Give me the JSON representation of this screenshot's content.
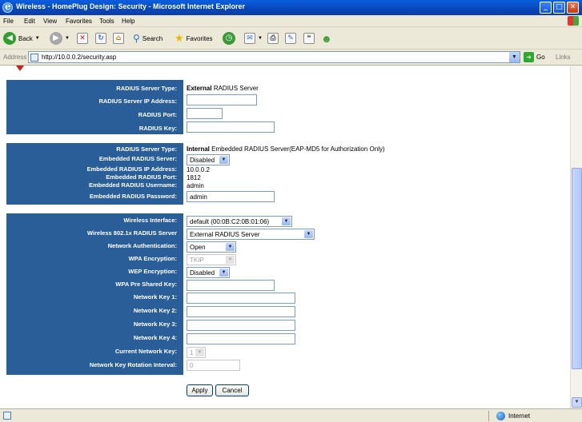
{
  "window": {
    "title": "Wireless - HomePlug Design: Security - Microsoft Internet Explorer",
    "minimize": "_",
    "maximize": "□",
    "close": "✕"
  },
  "menu": [
    "File",
    "Edit",
    "View",
    "Favorites",
    "Tools",
    "Help"
  ],
  "toolbar": {
    "back": "Back",
    "search": "Search",
    "favorites": "Favorites"
  },
  "address": {
    "label": "Address",
    "url": "http://10.0.0.2/security.asp",
    "go": "Go",
    "links": "Links"
  },
  "external_radius": {
    "type_label": "RADIUS Server Type:",
    "type_bold": "External",
    "type_rest": "RADIUS Server",
    "ip_label": "RADIUS Server IP Address:",
    "ip_value": "",
    "port_label": "RADIUS Port:",
    "port_value": "",
    "key_label": "RADIUS Key:",
    "key_value": ""
  },
  "internal_radius": {
    "type_label": "RADIUS Server Type:",
    "type_bold": "Internal",
    "type_rest": "Embedded RADIUS Server(EAP-MD5 for Authorization Only)",
    "server_label": "Embedded RADIUS Server:",
    "server_value": "Disabled",
    "ip_label": "Embedded RADIUS IP Address:",
    "ip_value": "10.0.0.2",
    "port_label": "Embedded RADIUS Port:",
    "port_value": "1812",
    "username_label": "Embedded RADIUS Username:",
    "username_value": "admin",
    "password_label": "Embedded RADIUS Password:",
    "password_value": "admin"
  },
  "wireless": {
    "interface_label": "Wireless Interface:",
    "interface_value": "default (00:0B:C2:0B:01:06)",
    "radius_label": "Wireless 802.1x RADIUS Server",
    "radius_value": "External RADIUS Server",
    "auth_label": "Network Authentication:",
    "auth_value": "Open",
    "wpa_enc_label": "WPA Encryption:",
    "wpa_enc_value": "TKIP",
    "wep_enc_label": "WEP Encryption:",
    "wep_enc_value": "Disabled",
    "wpa_psk_label": "WPA Pre Shared Key:",
    "wpa_psk_value": "",
    "key1_label": "Network Key 1:",
    "key2_label": "Network Key 2:",
    "key3_label": "Network Key 3:",
    "key4_label": "Network Key 4:",
    "current_key_label": "Current Network Key:",
    "current_key_value": "1",
    "rotation_label": "Network Key Rotation Interval:",
    "rotation_value": "0"
  },
  "buttons": {
    "apply": "Apply",
    "cancel": "Cancel"
  },
  "status": {
    "zone": "Internet"
  }
}
